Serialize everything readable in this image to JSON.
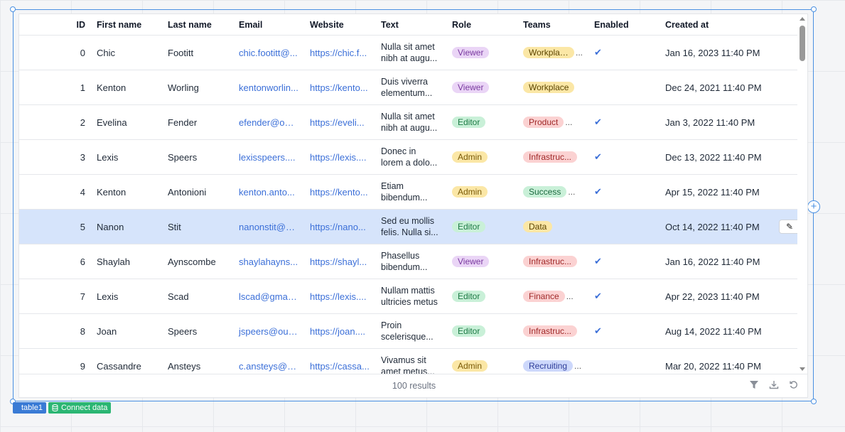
{
  "table": {
    "columns": [
      "ID",
      "First name",
      "Last name",
      "Email",
      "Website",
      "Text",
      "Role",
      "Teams",
      "Enabled",
      "Created at"
    ],
    "rows": [
      {
        "id": "0",
        "first": "Chic",
        "last": "Footitt",
        "email": "chic.footitt@...",
        "website": "https://chic.f...",
        "text1": "Nulla sit amet",
        "text2": "nibh at augu...",
        "role": "Viewer",
        "team": "Workplace",
        "team_more": "...",
        "enabled": true,
        "created": "Jan 16, 2023 11:40 PM"
      },
      {
        "id": "1",
        "first": "Kenton",
        "last": "Worling",
        "email": "kentonworlin...",
        "website": "https://kento...",
        "text1": "Duis viverra",
        "text2": "elementum...",
        "role": "Viewer",
        "team": "Workplace",
        "team_more": "",
        "enabled": false,
        "created": "Dec 24, 2021 11:40 PM"
      },
      {
        "id": "2",
        "first": "Evelina",
        "last": "Fender",
        "email": "efender@out...",
        "website": "https://eveli...",
        "text1": "Nulla sit amet",
        "text2": "nibh at augu...",
        "role": "Editor",
        "team": "Product",
        "team_more": "...",
        "enabled": true,
        "created": "Jan 3, 2022 11:40 PM"
      },
      {
        "id": "3",
        "first": "Lexis",
        "last": "Speers",
        "email": "lexisspeers....",
        "website": "https://lexis....",
        "text1": "Donec in",
        "text2": "lorem a dolo...",
        "role": "Admin",
        "team": "Infrastruc...",
        "team_more": "",
        "enabled": true,
        "created": "Dec 13, 2022 11:40 PM"
      },
      {
        "id": "4",
        "first": "Kenton",
        "last": "Antonioni",
        "email": "kenton.anto...",
        "website": "https://kento...",
        "text1": "Etiam",
        "text2": "bibendum...",
        "role": "Admin",
        "team": "Success",
        "team_more": "...",
        "enabled": true,
        "created": "Apr 15, 2022 11:40 PM"
      },
      {
        "id": "5",
        "first": "Nanon",
        "last": "Stit",
        "email": "nanonstit@g...",
        "website": "https://nano...",
        "text1": "Sed eu mollis",
        "text2": "felis. Nulla si...",
        "role": "Editor",
        "team": "Data",
        "team_more": "",
        "enabled": false,
        "created": "Oct 14, 2022 11:40 PM",
        "selected": true
      },
      {
        "id": "6",
        "first": "Shaylah",
        "last": "Aynscombe",
        "email": "shaylahayns...",
        "website": "https://shayl...",
        "text1": "Phasellus",
        "text2": "bibendum...",
        "role": "Viewer",
        "team": "Infrastruc...",
        "team_more": "",
        "enabled": true,
        "created": "Jan 16, 2022 11:40 PM"
      },
      {
        "id": "7",
        "first": "Lexis",
        "last": "Scad",
        "email": "lscad@gmail...",
        "website": "https://lexis....",
        "text1": "Nullam mattis",
        "text2": "ultricies metus",
        "role": "Editor",
        "team": "Finance",
        "team_more": "...",
        "enabled": true,
        "created": "Apr 22, 2023 11:40 PM"
      },
      {
        "id": "8",
        "first": "Joan",
        "last": "Speers",
        "email": "jspeers@outl...",
        "website": "https://joan....",
        "text1": "Proin",
        "text2": "scelerisque...",
        "role": "Editor",
        "team": "Infrastruc...",
        "team_more": "",
        "enabled": true,
        "created": "Aug 14, 2022 11:40 PM"
      },
      {
        "id": "9",
        "first": "Cassandre",
        "last": "Ansteys",
        "email": "c.ansteys@y...",
        "website": "https://cassa...",
        "text1": "Vivamus sit",
        "text2": "amet metus...",
        "role": "Admin",
        "team": "Recruiting",
        "team_more": "...",
        "enabled": false,
        "created": "Mar 20, 2022 11:40 PM"
      }
    ],
    "results": "100 results",
    "check_glyph": "✔",
    "edit_glyph": "✎"
  },
  "role_colors": {
    "Viewer": {
      "bg": "#ead5f6",
      "fg": "#7a3aa0"
    },
    "Editor": {
      "bg": "#c9f0d8",
      "fg": "#1d7a45"
    },
    "Admin": {
      "bg": "#fbe7a6",
      "fg": "#7a5a06"
    }
  },
  "team_colors": {
    "Workplace": {
      "bg": "#fbe7a6",
      "fg": "#5c4500"
    },
    "Product": {
      "bg": "#fbd2d2",
      "fg": "#a02a2a"
    },
    "Infrastruc...": {
      "bg": "#fbd2d2",
      "fg": "#a02a2a"
    },
    "Success": {
      "bg": "#c9f0d8",
      "fg": "#1d6a40"
    },
    "Data": {
      "bg": "#fbe7a6",
      "fg": "#5c4500"
    },
    "Finance": {
      "bg": "#fbd2d2",
      "fg": "#a02a2a"
    },
    "Recruiting": {
      "bg": "#cdd8fb",
      "fg": "#2f3e9a"
    }
  },
  "component_tags": {
    "name": "table1",
    "connect": "Connect data"
  },
  "colors": {
    "accent": "#4a90e2",
    "link": "#3b6fd8",
    "selected_row": "#d6e4fb"
  }
}
